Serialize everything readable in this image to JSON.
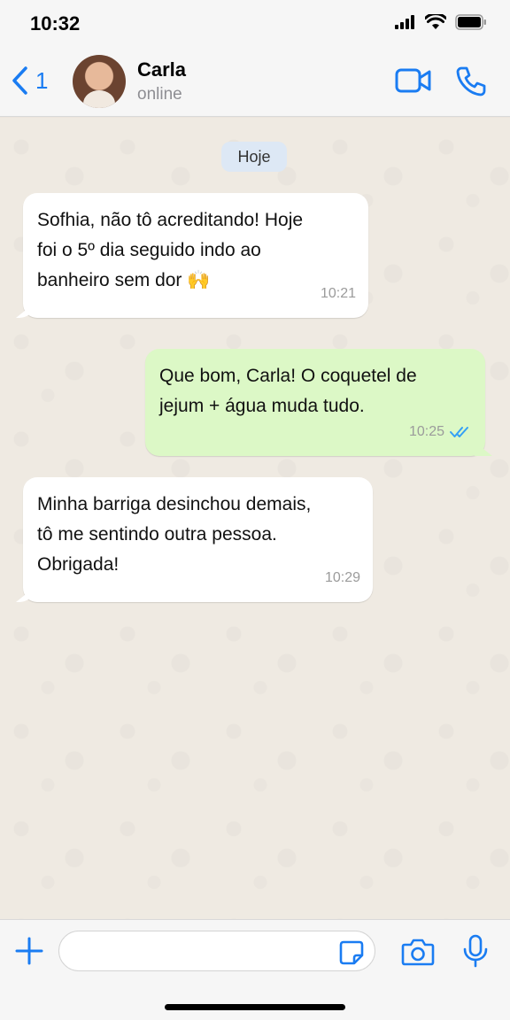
{
  "status_bar": {
    "time": "10:32",
    "icons": [
      "signal-icon",
      "wifi-icon",
      "battery-icon"
    ]
  },
  "header": {
    "back_count": "1",
    "contact_name": "Carla",
    "contact_status": "online",
    "icons": [
      "chevron-left-icon",
      "video-camera-icon",
      "phone-icon"
    ]
  },
  "chat": {
    "date_label": "Hoje",
    "messages": [
      {
        "direction": "incoming",
        "text": "Sofhia, não tô acreditando! Hoje\nfoi o 5º dia seguido indo ao\nbanheiro sem dor 🙌",
        "time": "10:21"
      },
      {
        "direction": "outgoing",
        "text": "Que bom, Carla! O coquetel de\njejum + água muda tudo.",
        "time": "10:25",
        "status": "read"
      },
      {
        "direction": "incoming",
        "text": "Minha barriga desinchou demais,\ntô me sentindo outra pessoa.\nObrigada!",
        "time": "10:29"
      }
    ]
  },
  "input_bar": {
    "placeholder": "",
    "icons": [
      "plus-icon",
      "sticker-icon",
      "camera-icon",
      "microphone-icon"
    ]
  },
  "colors": {
    "accent": "#1a7cf2",
    "outgoing_bubble": "#dcf8c6",
    "incoming_bubble": "#ffffff",
    "chat_background": "#efeae2"
  }
}
